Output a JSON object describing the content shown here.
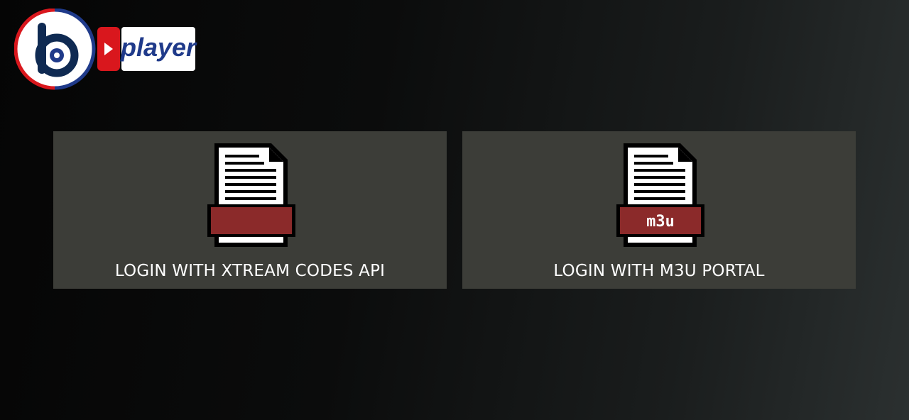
{
  "app": {
    "logo_letter": "b",
    "logo_wordmark": "player",
    "logo_icon": "play-icon"
  },
  "tiles": [
    {
      "label": "LOGIN WITH XTREAM CODES API",
      "icon": "document-icon",
      "banner_text": ""
    },
    {
      "label": "LOGIN WITH M3U PORTAL",
      "icon": "m3u-file-icon",
      "banner_text": "m3u"
    }
  ],
  "colors": {
    "tile_background": "#3c3d38",
    "banner_red": "#8b2a2a",
    "logo_red": "#d9171d",
    "logo_blue": "#1f3a8a",
    "logo_navy": "#0f2a52"
  }
}
